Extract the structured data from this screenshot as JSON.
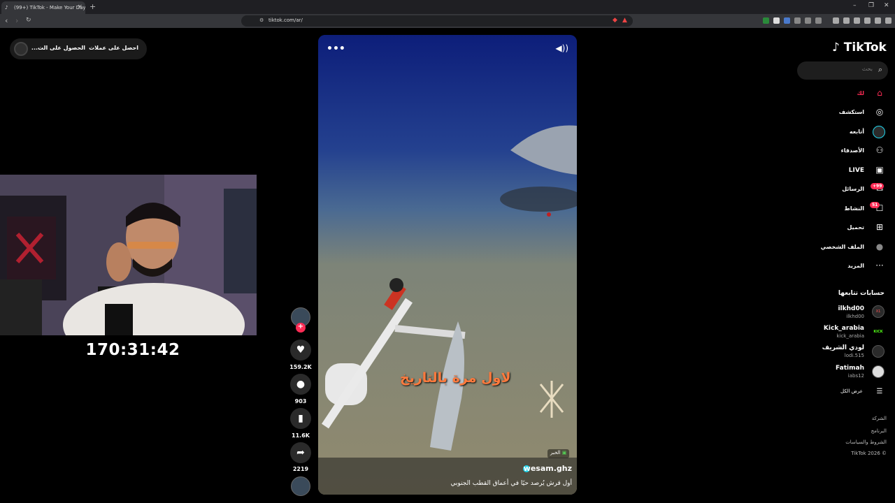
{
  "browser": {
    "tab_title": "(99+) TikTok - Make Your Day",
    "url": "tiktok.com/ar/"
  },
  "topchip": {
    "get_coins": "احصل على عملات",
    "get_app": "الحصول على الت..."
  },
  "stream": {
    "timer": "170:31:42"
  },
  "video": {
    "overlay_text": "لاول مرة بالتاريخ",
    "news_badge": "الخبر",
    "author": "wesam.ghz",
    "description": "أول قرش يُرصد حيًا في أعماق القطب الجنوبي"
  },
  "actions": {
    "likes": "159.2K",
    "comments": "903",
    "saves": "11.6K",
    "shares": "2219"
  },
  "sidebar": {
    "logo": "TikTok",
    "search_placeholder": "بحث",
    "nav": [
      {
        "label": "لك",
        "icon": "home-icon"
      },
      {
        "label": "استكشف",
        "icon": "compass-icon"
      },
      {
        "label": "أتابعه",
        "icon": "following-avatar-icon"
      },
      {
        "label": "الأصدقاء",
        "icon": "friends-icon"
      },
      {
        "label": "LIVE",
        "icon": "live-icon"
      },
      {
        "label": "الرسائل",
        "icon": "messages-icon",
        "badge": "+99"
      },
      {
        "label": "النشاط",
        "icon": "activity-icon",
        "badge": "51"
      },
      {
        "label": "تحميل",
        "icon": "upload-icon"
      },
      {
        "label": "الملف الشخصي",
        "icon": "profile-icon"
      },
      {
        "label": "المزيد",
        "icon": "more-icon"
      }
    ],
    "following_heading": "حسابات تتابعها",
    "accounts": [
      {
        "name": "ilkhd00",
        "handle": "ilkhd00"
      },
      {
        "name": "Kick_arabia",
        "handle": "kick_arabia"
      },
      {
        "name": "لودي الشريف",
        "handle": "lodi.515"
      },
      {
        "name": "Fatimah",
        "handle": "iabs12"
      }
    ],
    "see_all": "عرض الكل",
    "footer": [
      "الشركة",
      "البرنامج",
      "الشروط والسياسات",
      "TikTok 2026 ©"
    ]
  },
  "colors": {
    "accent": "#fe2c55",
    "kick_green": "#53fc18",
    "verified": "#20d5ec"
  }
}
